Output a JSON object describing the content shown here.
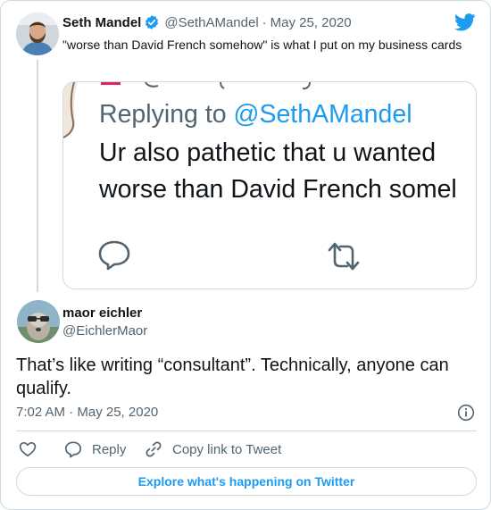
{
  "colors": {
    "accent": "#1d9bf0",
    "text": "#0f1419",
    "muted": "#536471",
    "border": "#cfd9de"
  },
  "parent_tweet": {
    "author_name": "Seth Mandel",
    "verified": true,
    "handle": "@SethAMandel",
    "separator": "·",
    "date": "May 25, 2020",
    "text": "\"worse than David French somehow\" is what I put on my business cards",
    "media": {
      "replying_prefix": "Replying to",
      "replying_handle": "@SethAMandel",
      "line1": "Ur also pathetic that u wanted",
      "line2": "worse than David French somel",
      "icons": [
        "comment-icon",
        "retweet-icon"
      ]
    }
  },
  "reply_tweet": {
    "author_name": "maor eichler",
    "handle": "@EichlerMaor",
    "text": "That’s like writing “consultant”. Technically, anyone can qualify.",
    "timestamp": "7:02 AM · May 25, 2020"
  },
  "actions": {
    "like_icon": "heart-icon",
    "reply_label": "Reply",
    "copy_label": "Copy link to Tweet"
  },
  "footer": {
    "explore_label": "Explore what's happening on Twitter"
  },
  "icons": {
    "brand": "twitter-bird-icon",
    "info": "info-icon",
    "verified": "verified-badge-icon"
  }
}
